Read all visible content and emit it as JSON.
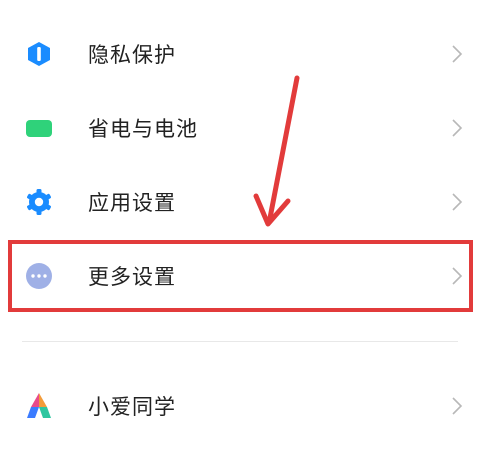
{
  "settings": {
    "items": [
      {
        "label": "隐私保护",
        "icon": "privacy-shield-icon",
        "icon_color": "#1a8cff"
      },
      {
        "label": "省电与电池",
        "icon": "battery-icon",
        "icon_color": "#2fd27a"
      },
      {
        "label": "应用设置",
        "icon": "gear-icon",
        "icon_color": "#1a8cff"
      },
      {
        "label": "更多设置",
        "icon": "more-dots-icon",
        "icon_color": "#9fb0e6"
      },
      {
        "label": "小爱同学",
        "icon": "xiaoai-icon",
        "icon_color": "#e94b8b"
      }
    ]
  },
  "annotation": {
    "color": "#e23b3b"
  }
}
